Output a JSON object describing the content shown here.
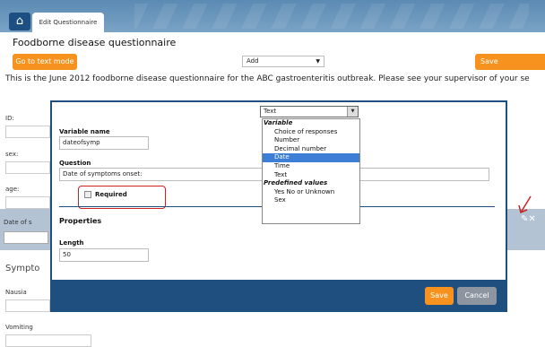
{
  "app": {
    "tab_label": "Edit Questionnaire",
    "home_icon": "home-icon"
  },
  "page": {
    "title": "Foodborne disease questionnaire",
    "text_mode_button": "Go to text mode",
    "add_select_value": "Add",
    "save_questionnaire_button": "Save questionnaire",
    "intro_text": "This is the June 2012 foodborne disease questionnaire for the ABC gastroenteritis outbreak. Please see your supervisor of your se"
  },
  "fields": [
    {
      "label": "ID:"
    },
    {
      "label": "sex:"
    },
    {
      "label": "age:"
    }
  ],
  "highlighted_row": {
    "label": "Date of s"
  },
  "section": {
    "title": "Sympto"
  },
  "symptom_fields": [
    {
      "label": "Nausia"
    },
    {
      "label": "Vomiting"
    }
  ],
  "modal": {
    "type_select_value": "Text",
    "variable_name_label": "Variable name",
    "variable_name_value": "dateofsymp",
    "question_label": "Question",
    "question_value": "Date of symptoms onset:",
    "required_label": "Required",
    "properties_label": "Properties",
    "length_label": "Length",
    "length_value": "50",
    "save_button": "Save",
    "cancel_button": "Cancel",
    "type_list": {
      "group_variable": "Variable",
      "options_variable": [
        "Choice of responses",
        "Number",
        "Decimal number",
        "Date",
        "Time",
        "Text"
      ],
      "selected": "Date",
      "group_predefined": "Predefined values",
      "options_predefined": [
        "Yes No or Unknown",
        "Sex"
      ]
    }
  },
  "colors": {
    "accent_orange": "#f7921e",
    "header_blue": "#5b8ab3",
    "modal_navy": "#1f4f7f",
    "annotation_red": "#cc2222"
  }
}
